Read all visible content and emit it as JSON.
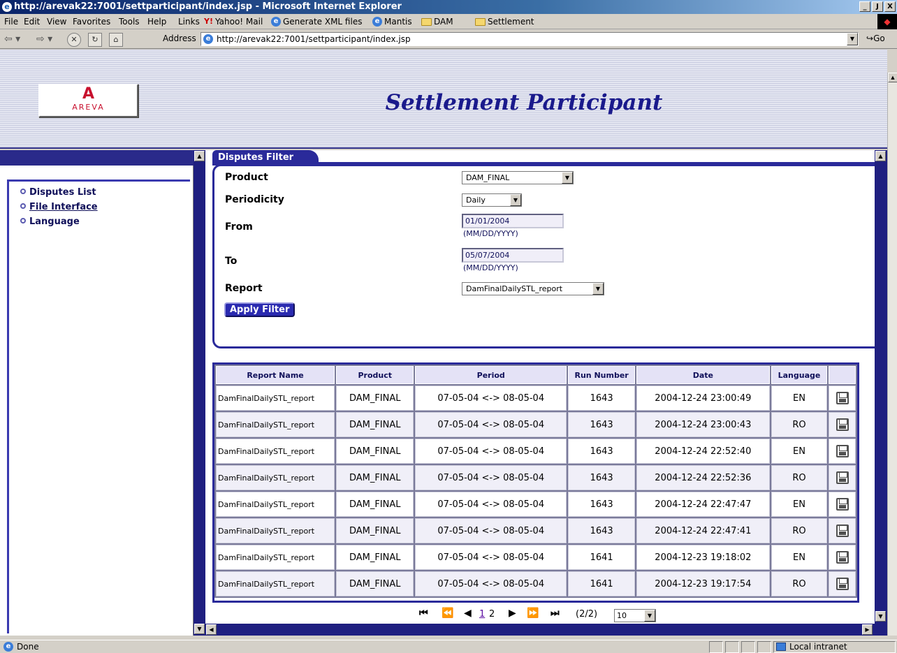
{
  "window": {
    "title": "http://arevak22:7001/settparticipant/index.jsp - Microsoft Internet Explorer",
    "controls": [
      "_",
      "Ј",
      "X"
    ]
  },
  "menu": {
    "items": [
      "File",
      "Edit",
      "View",
      "Favorites",
      "Tools",
      "Help"
    ],
    "links_label": "Links",
    "links": [
      "Yahoo! Mail",
      "Generate XML files",
      "Mantis",
      "DAM",
      "Settlement"
    ]
  },
  "navbar": {
    "address_label": "Address",
    "url": "http://arevak22:7001/settparticipant/index.jsp",
    "go_label": "Go"
  },
  "header": {
    "logo_text": "AREVA",
    "title": "Settlement Participant"
  },
  "sidebar": {
    "items": [
      {
        "label": "Disputes List"
      },
      {
        "label": "File Interface"
      },
      {
        "label": "Language"
      }
    ]
  },
  "filter": {
    "tab_label": "Disputes Filter",
    "product": {
      "label": "Product",
      "value": "DAM_FINAL"
    },
    "periodicity": {
      "label": "Periodicity",
      "value": "Daily"
    },
    "from": {
      "label": "From",
      "value": "01/01/2004",
      "format": "(MM/DD/YYYY)"
    },
    "to": {
      "label": "To",
      "value": "05/07/2004",
      "format": "(MM/DD/YYYY)"
    },
    "report": {
      "label": "Report",
      "value": "DamFinalDailySTL_report"
    },
    "apply_label": "Apply Filter"
  },
  "table": {
    "columns": [
      "Report Name",
      "Product",
      "Period",
      "Run Number",
      "Date",
      "Language",
      ""
    ],
    "rows": [
      {
        "report": "DamFinalDailySTL_report",
        "product": "DAM_FINAL",
        "period": "07-05-04 <-> 08-05-04",
        "run": "1643",
        "date": "2004-12-24 23:00:49",
        "lang": "EN"
      },
      {
        "report": "DamFinalDailySTL_report",
        "product": "DAM_FINAL",
        "period": "07-05-04 <-> 08-05-04",
        "run": "1643",
        "date": "2004-12-24 23:00:43",
        "lang": "RO"
      },
      {
        "report": "DamFinalDailySTL_report",
        "product": "DAM_FINAL",
        "period": "07-05-04 <-> 08-05-04",
        "run": "1643",
        "date": "2004-12-24 22:52:40",
        "lang": "EN"
      },
      {
        "report": "DamFinalDailySTL_report",
        "product": "DAM_FINAL",
        "period": "07-05-04 <-> 08-05-04",
        "run": "1643",
        "date": "2004-12-24 22:52:36",
        "lang": "RO"
      },
      {
        "report": "DamFinalDailySTL_report",
        "product": "DAM_FINAL",
        "period": "07-05-04 <-> 08-05-04",
        "run": "1643",
        "date": "2004-12-24 22:47:47",
        "lang": "EN"
      },
      {
        "report": "DamFinalDailySTL_report",
        "product": "DAM_FINAL",
        "period": "07-05-04 <-> 08-05-04",
        "run": "1643",
        "date": "2004-12-24 22:47:41",
        "lang": "RO"
      },
      {
        "report": "DamFinalDailySTL_report",
        "product": "DAM_FINAL",
        "period": "07-05-04 <-> 08-05-04",
        "run": "1641",
        "date": "2004-12-23 19:18:02",
        "lang": "EN"
      },
      {
        "report": "DamFinalDailySTL_report",
        "product": "DAM_FINAL",
        "period": "07-05-04 <-> 08-05-04",
        "run": "1641",
        "date": "2004-12-23 19:17:54",
        "lang": "RO"
      }
    ]
  },
  "pager": {
    "pages": [
      "1",
      "2"
    ],
    "current_page": "1",
    "count_text": "(2/2)",
    "page_size": "10"
  },
  "status": {
    "text": "Done",
    "zone": "Local intranet"
  },
  "colors": {
    "accent": "#2a2a9a",
    "title_blue": "#1a1a8c",
    "brand_red": "#c8102e"
  }
}
